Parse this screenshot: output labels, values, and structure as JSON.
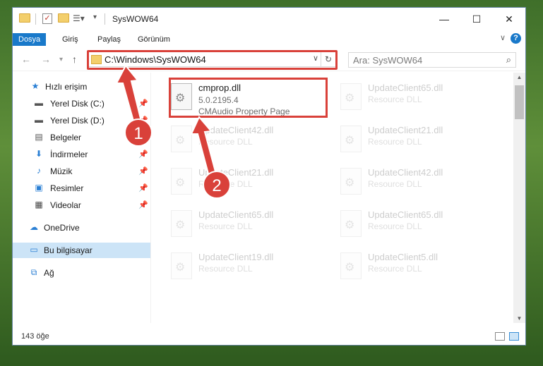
{
  "window": {
    "title": "SysWOW64"
  },
  "ribbon": {
    "tabs": [
      {
        "label": "Dosya",
        "active": true
      },
      {
        "label": "Giriş"
      },
      {
        "label": "Paylaş"
      },
      {
        "label": "Görünüm"
      }
    ],
    "help_label": "?"
  },
  "address": {
    "path": "C:\\Windows\\SysWOW64",
    "search_placeholder": "Ara: SysWOW64"
  },
  "nav": {
    "items": [
      {
        "label": "Hızlı erişim",
        "icon": "star-icon"
      },
      {
        "label": "Yerel Disk (C:)",
        "icon": "drive-icon",
        "pinned": true
      },
      {
        "label": "Yerel Disk (D:)",
        "icon": "drive-icon",
        "pinned": true
      },
      {
        "label": "Belgeler",
        "icon": "documents-icon",
        "pinned": true
      },
      {
        "label": "İndirmeler",
        "icon": "downloads-icon",
        "pinned": true
      },
      {
        "label": "Müzik",
        "icon": "music-icon",
        "pinned": true
      },
      {
        "label": "Resimler",
        "icon": "pictures-icon",
        "pinned": true
      },
      {
        "label": "Videolar",
        "icon": "videos-icon",
        "pinned": true
      },
      {
        "label": "OneDrive",
        "icon": "cloud-icon"
      },
      {
        "label": "Bu bilgisayar",
        "icon": "computer-icon",
        "selected": true
      },
      {
        "label": "Ağ",
        "icon": "network-icon"
      }
    ]
  },
  "files": [
    {
      "name": "cmprop.dll",
      "version": "5.0.2195.4",
      "desc": "CMAudio Property Page",
      "highlighted": true
    },
    {
      "name": "UpdateClient65.dll",
      "desc": "Resource DLL"
    },
    {
      "name": "UpdateClient42.dll",
      "desc": "Resource DLL"
    },
    {
      "name": "UpdateClient21.dll",
      "desc": "Resource DLL"
    },
    {
      "name": "UpdateClient21.dll",
      "desc": "Resource DLL"
    },
    {
      "name": "UpdateClient42.dll",
      "desc": "Resource DLL"
    },
    {
      "name": "UpdateClient65.dll",
      "desc": "Resource DLL"
    },
    {
      "name": "UpdateClient65.dll",
      "desc": "Resource DLL"
    },
    {
      "name": "UpdateClient19.dll",
      "desc": "Resource DLL"
    },
    {
      "name": "UpdateClient5.dll",
      "desc": "Resource DLL"
    }
  ],
  "status": {
    "count": "143 öğe"
  },
  "callouts": {
    "one": "1",
    "two": "2"
  },
  "colors": {
    "accent": "#1979ca",
    "highlight": "#d9413a",
    "selected": "#cce4f7"
  }
}
